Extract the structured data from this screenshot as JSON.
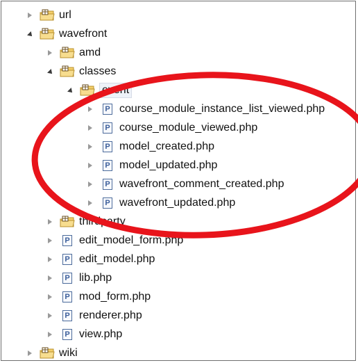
{
  "tree": [
    {
      "label": "url",
      "kind": "package",
      "state": "closed",
      "depth": 0
    },
    {
      "label": "wavefront",
      "kind": "package",
      "state": "open",
      "depth": 0
    },
    {
      "label": "amd",
      "kind": "package",
      "state": "closed",
      "depth": 1
    },
    {
      "label": "classes",
      "kind": "package",
      "state": "open",
      "depth": 1
    },
    {
      "label": "event",
      "kind": "package",
      "state": "open",
      "depth": 2,
      "selected": true
    },
    {
      "label": "course_module_instance_list_viewed.php",
      "kind": "php",
      "state": "closed",
      "depth": 3
    },
    {
      "label": "course_module_viewed.php",
      "kind": "php",
      "state": "closed",
      "depth": 3
    },
    {
      "label": "model_created.php",
      "kind": "php",
      "state": "closed",
      "depth": 3
    },
    {
      "label": "model_updated.php",
      "kind": "php",
      "state": "closed",
      "depth": 3
    },
    {
      "label": "wavefront_comment_created.php",
      "kind": "php",
      "state": "closed",
      "depth": 3
    },
    {
      "label": "wavefront_updated.php",
      "kind": "php",
      "state": "closed",
      "depth": 3
    },
    {
      "label": "thirdparty",
      "kind": "package",
      "state": "closed",
      "depth": 1
    },
    {
      "label": "edit_model_form.php",
      "kind": "php",
      "state": "closed",
      "depth": 1
    },
    {
      "label": "edit_model.php",
      "kind": "php",
      "state": "closed",
      "depth": 1
    },
    {
      "label": "lib.php",
      "kind": "php",
      "state": "closed",
      "depth": 1
    },
    {
      "label": "mod_form.php",
      "kind": "php",
      "state": "closed",
      "depth": 1
    },
    {
      "label": "renderer.php",
      "kind": "php",
      "state": "closed",
      "depth": 1
    },
    {
      "label": "view.php",
      "kind": "php",
      "state": "closed",
      "depth": 1
    },
    {
      "label": "wiki",
      "kind": "package",
      "state": "closed",
      "depth": 0
    }
  ],
  "icons": {
    "php_letter": "P"
  },
  "colors": {
    "annotation": "#e8141b",
    "folder": "#f4cf6b",
    "php_border": "#4c6b9b"
  }
}
